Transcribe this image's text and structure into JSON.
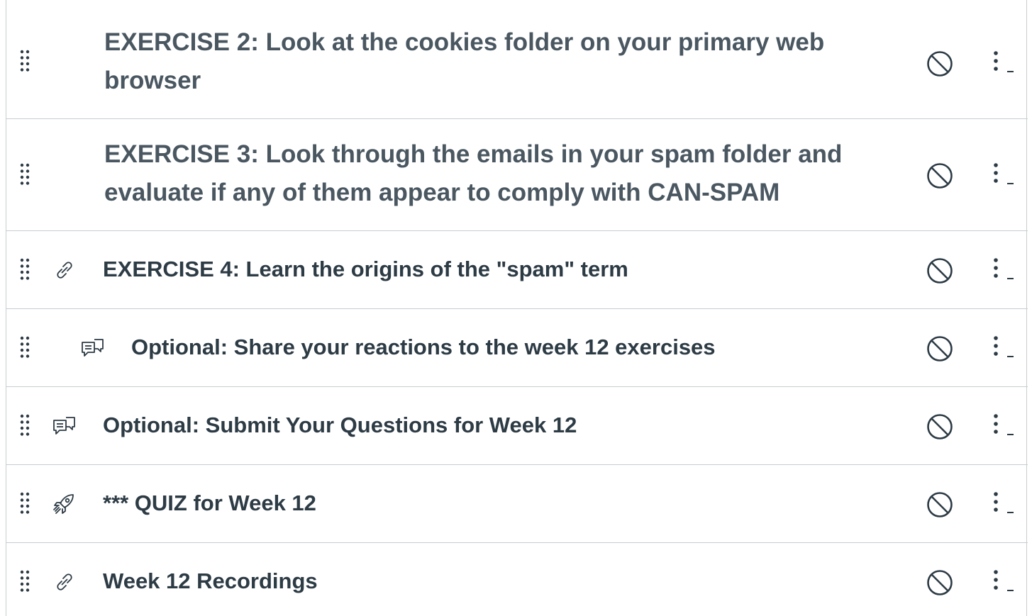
{
  "module_items": [
    {
      "title": "EXERCISE 2: Look at the cookies folder on your primary web browser",
      "type_icon": "none",
      "publish_state_icon": "unpublished-icon",
      "menu_icon": "kebab-menu-icon"
    },
    {
      "title": "EXERCISE 3: Look through the emails in your spam folder and evaluate if any of them appear to comply with CAN-SPAM",
      "type_icon": "none",
      "publish_state_icon": "unpublished-icon",
      "menu_icon": "kebab-menu-icon"
    },
    {
      "title": "EXERCISE 4: Learn the origins of the \"spam\" term",
      "type_icon": "link-icon",
      "publish_state_icon": "unpublished-icon",
      "menu_icon": "kebab-menu-icon"
    },
    {
      "title": "Optional: Share your reactions to the week 12 exercises",
      "type_icon": "discussion-icon",
      "indented": true,
      "publish_state_icon": "unpublished-icon",
      "menu_icon": "kebab-menu-icon"
    },
    {
      "title": "Optional: Submit Your Questions for Week 12",
      "type_icon": "discussion-icon",
      "publish_state_icon": "unpublished-icon",
      "menu_icon": "kebab-menu-icon"
    },
    {
      "title": "*** QUIZ for Week 12",
      "type_icon": "quiz-rocket-icon",
      "publish_state_icon": "unpublished-icon",
      "menu_icon": "kebab-menu-icon"
    },
    {
      "title": "Week 12 Recordings",
      "type_icon": "link-icon",
      "publish_state_icon": "unpublished-icon",
      "menu_icon": "kebab-menu-icon"
    }
  ],
  "colors": {
    "text": "#2d3b45",
    "header_text": "#4a5761",
    "border": "#c7cdd1",
    "icon": "#2d3b45"
  }
}
